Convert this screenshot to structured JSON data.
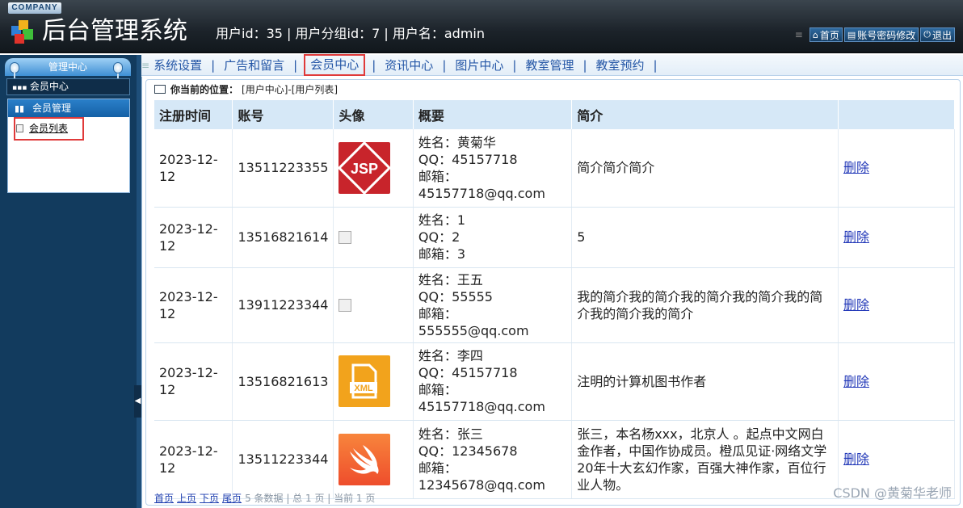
{
  "header": {
    "company": "COMPANY",
    "title": "后台管理系统",
    "user_info": "用户id：35 | 用户分组id：7 | 用户名：admin",
    "links": [
      {
        "label": "首页",
        "icon": "home-icon"
      },
      {
        "label": "账号密码修改",
        "icon": "document-icon"
      },
      {
        "label": "退出",
        "icon": "power-icon"
      }
    ]
  },
  "sidebar": {
    "section_title": "管理中心",
    "active_center": "会员中心",
    "panel_title": "会员管理",
    "items": [
      {
        "label": "会员列表"
      }
    ]
  },
  "nav": {
    "tabs": [
      {
        "label": "系统设置"
      },
      {
        "label": "广告和留言"
      },
      {
        "label": "会员中心"
      },
      {
        "label": "资讯中心"
      },
      {
        "label": "图片中心"
      },
      {
        "label": "教室管理"
      },
      {
        "label": "教室预约"
      }
    ]
  },
  "breadcrumb": {
    "label": "你当前的位置：",
    "path": "[用户中心]-[用户列表]"
  },
  "table": {
    "columns": [
      "注册时间",
      "账号",
      "头像",
      "概要",
      "简介",
      ""
    ],
    "rows": [
      {
        "time": "2023-12-12",
        "account": "13511223355",
        "avatar": "jsp-icon",
        "avatar_text": "JSP",
        "name": "姓名：黄菊华",
        "qq": "QQ：45157718",
        "email": "邮箱：45157718@qq.com",
        "intro": "简介简介简介",
        "action": "删除"
      },
      {
        "time": "2023-12-12",
        "account": "13516821614",
        "avatar": "broken-image-icon",
        "avatar_text": "",
        "name": "姓名：1",
        "qq": "QQ：2",
        "email": "邮箱：3",
        "intro": "5",
        "action": "删除"
      },
      {
        "time": "2023-12-12",
        "account": "13911223344",
        "avatar": "broken-image-icon",
        "avatar_text": "",
        "name": "姓名：王五",
        "qq": "QQ：55555",
        "email": "邮箱：555555@qq.com",
        "intro": "我的简介我的简介我的简介我的简介我的简介我的简介我的简介",
        "action": "删除"
      },
      {
        "time": "2023-12-12",
        "account": "13516821613",
        "avatar": "xml-file-icon",
        "avatar_text": "XML",
        "name": "姓名：李四",
        "qq": "QQ：45157718",
        "email": "邮箱：45157718@qq.com",
        "intro": "注明的计算机图书作者",
        "action": "删除"
      },
      {
        "time": "2023-12-12",
        "account": "13511223344",
        "avatar": "swift-icon",
        "avatar_text": "",
        "name": "姓名：张三",
        "qq": "QQ：12345678",
        "email": "邮箱：12345678@qq.com",
        "intro": "张三，本名杨xxx，北京人 。起点中文网白金作者，中国作协成员。橙瓜见证·网络文学20年十大玄幻作家，百强大神作家，百位行业人物。",
        "action": "删除"
      }
    ]
  },
  "pager": {
    "first": "首页",
    "prev": "上页",
    "next": "下页",
    "last": "尾页",
    "summary": "5 条数据 | 总 1 页 | 当前 1 页"
  },
  "watermark": "CSDN @黄菊华老师",
  "colors": {
    "accent": "#2456a6",
    "highlight": "#e03a3a",
    "header_bg": "#1c232a",
    "table_head": "#d6e8f7"
  }
}
